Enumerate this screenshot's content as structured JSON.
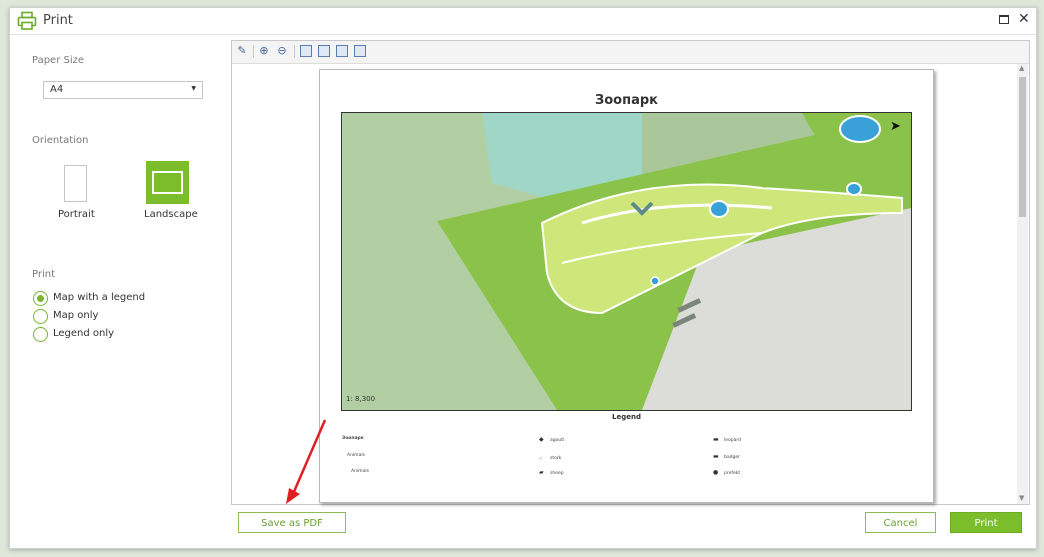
{
  "window": {
    "title": "Print"
  },
  "left_panel": {
    "paper_size_label": "Paper Size",
    "paper_size_value": "A4",
    "orientation_label": "Orientation",
    "orientations": [
      "Portrait",
      "Landscape"
    ],
    "selected_orientation": "Landscape",
    "print_label": "Print",
    "print_options": [
      "Map with a legend",
      "Map only",
      "Legend only"
    ],
    "selected_print_option": "Map with a legend"
  },
  "preview": {
    "page_title": "Зоопарк",
    "scale_text": "1: 8,300",
    "legend_title": "Legend",
    "legend_col1": [
      "Зоопарк",
      "Animals",
      "Animals"
    ],
    "legend_col2": [
      "agouti",
      "stork",
      "sheep"
    ],
    "legend_col3": [
      "leopard",
      "badger",
      "prefekt"
    ]
  },
  "buttons": {
    "save_pdf": "Save as PDF",
    "cancel": "Cancel",
    "print": "Print"
  },
  "colors": {
    "accent": "#7bbd2a",
    "map_green": "#8bc34a",
    "water": "#3aa0d8"
  },
  "icons": [
    "printer-icon",
    "maximize-icon",
    "close-icon",
    "brush-icon",
    "zoom-in-icon",
    "zoom-out-icon",
    "fit-page-icon",
    "fit-width-icon",
    "one-page-icon",
    "two-page-icon",
    "north-arrow-icon"
  ]
}
